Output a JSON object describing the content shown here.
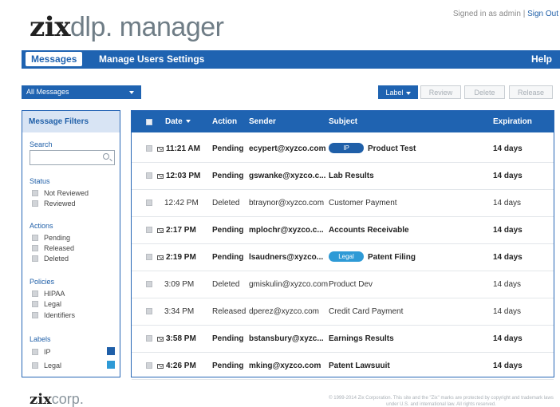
{
  "header": {
    "logo_zix": "zix",
    "logo_rest": "dlp. manager",
    "signed_in": "Signed in as admin | ",
    "sign_out": "Sign Out"
  },
  "nav": {
    "items": [
      {
        "label": "Messages",
        "active": true
      },
      {
        "label": "Manage Users",
        "active": false
      },
      {
        "label": "Settings",
        "active": false
      }
    ],
    "help": "Help"
  },
  "toolbar": {
    "filter_select": "All Messages",
    "label_btn": "Label",
    "review_btn": "Review",
    "delete_btn": "Delete",
    "release_btn": "Release"
  },
  "filters": {
    "title": "Message Filters",
    "search_label": "Search",
    "search_value": "",
    "status_label": "Status",
    "status_items": [
      "Not Reviewed",
      "Reviewed"
    ],
    "actions_label": "Actions",
    "action_items": [
      "Pending",
      "Released",
      "Deleted"
    ],
    "policies_label": "Policies",
    "policy_items": [
      "HIPAA",
      "Legal",
      "Identifiers"
    ],
    "labels_label": "Labels",
    "label_items": [
      {
        "name": "IP",
        "color": "#1f5fa8"
      },
      {
        "name": "Legal",
        "color": "#2e9ad6"
      }
    ]
  },
  "table": {
    "columns": [
      "Date",
      "Action",
      "Sender",
      "Subject",
      "Expiration"
    ],
    "rows": [
      {
        "date": "11:21 AM",
        "action": "Pending",
        "sender": "ecypert@xyzco.com",
        "tag": "IP",
        "subject": "Product Test",
        "expiration": "14 days",
        "unread": true
      },
      {
        "date": "12:03 PM",
        "action": "Pending",
        "sender": "gswanke@xyzco.c...",
        "tag": "",
        "subject": "Lab Results",
        "expiration": "14 days",
        "unread": true
      },
      {
        "date": "12:42 PM",
        "action": "Deleted",
        "sender": "btraynor@xyzco.com",
        "tag": "",
        "subject": "Customer Payment",
        "expiration": "14 days",
        "unread": false
      },
      {
        "date": "2:17 PM",
        "action": "Pending",
        "sender": "mplochr@xyzco.c...",
        "tag": "",
        "subject": "Accounts Receivable",
        "expiration": "14 days",
        "unread": true
      },
      {
        "date": "2:19 PM",
        "action": "Pending",
        "sender": "lsaudners@xyzco...",
        "tag": "Legal",
        "subject": "Patent Filing",
        "expiration": "14 days",
        "unread": true
      },
      {
        "date": "3:09 PM",
        "action": "Deleted",
        "sender": "gmiskulin@xyzco.com",
        "tag": "",
        "subject": "Product Dev",
        "expiration": "14 days",
        "unread": false
      },
      {
        "date": "3:34 PM",
        "action": "Released",
        "sender": "dperez@xyzco.com",
        "tag": "",
        "subject": "Credit Card Payment",
        "expiration": "14 days",
        "unread": false
      },
      {
        "date": "3:58 PM",
        "action": "Pending",
        "sender": "bstansbury@xyzc...",
        "tag": "",
        "subject": "Earnings Results",
        "expiration": "14 days",
        "unread": true
      },
      {
        "date": "4:26 PM",
        "action": "Pending",
        "sender": "mking@xyzco.com",
        "tag": "",
        "subject": "Patent Lawsuuit",
        "expiration": "14 days",
        "unread": true
      }
    ]
  },
  "footer": {
    "logo_zix": "zix",
    "logo_rest": "corp.",
    "copyright": "© 1999-2014 Zix Corporation. This site and the \"Zix\" marks are protected by copyright and trademark laws under U.S. and international law. All rights reserved."
  },
  "colors": {
    "brand_blue": "#1f63b1",
    "ip_tag": "#1f5fa8",
    "legal_tag": "#2e9ad6"
  }
}
